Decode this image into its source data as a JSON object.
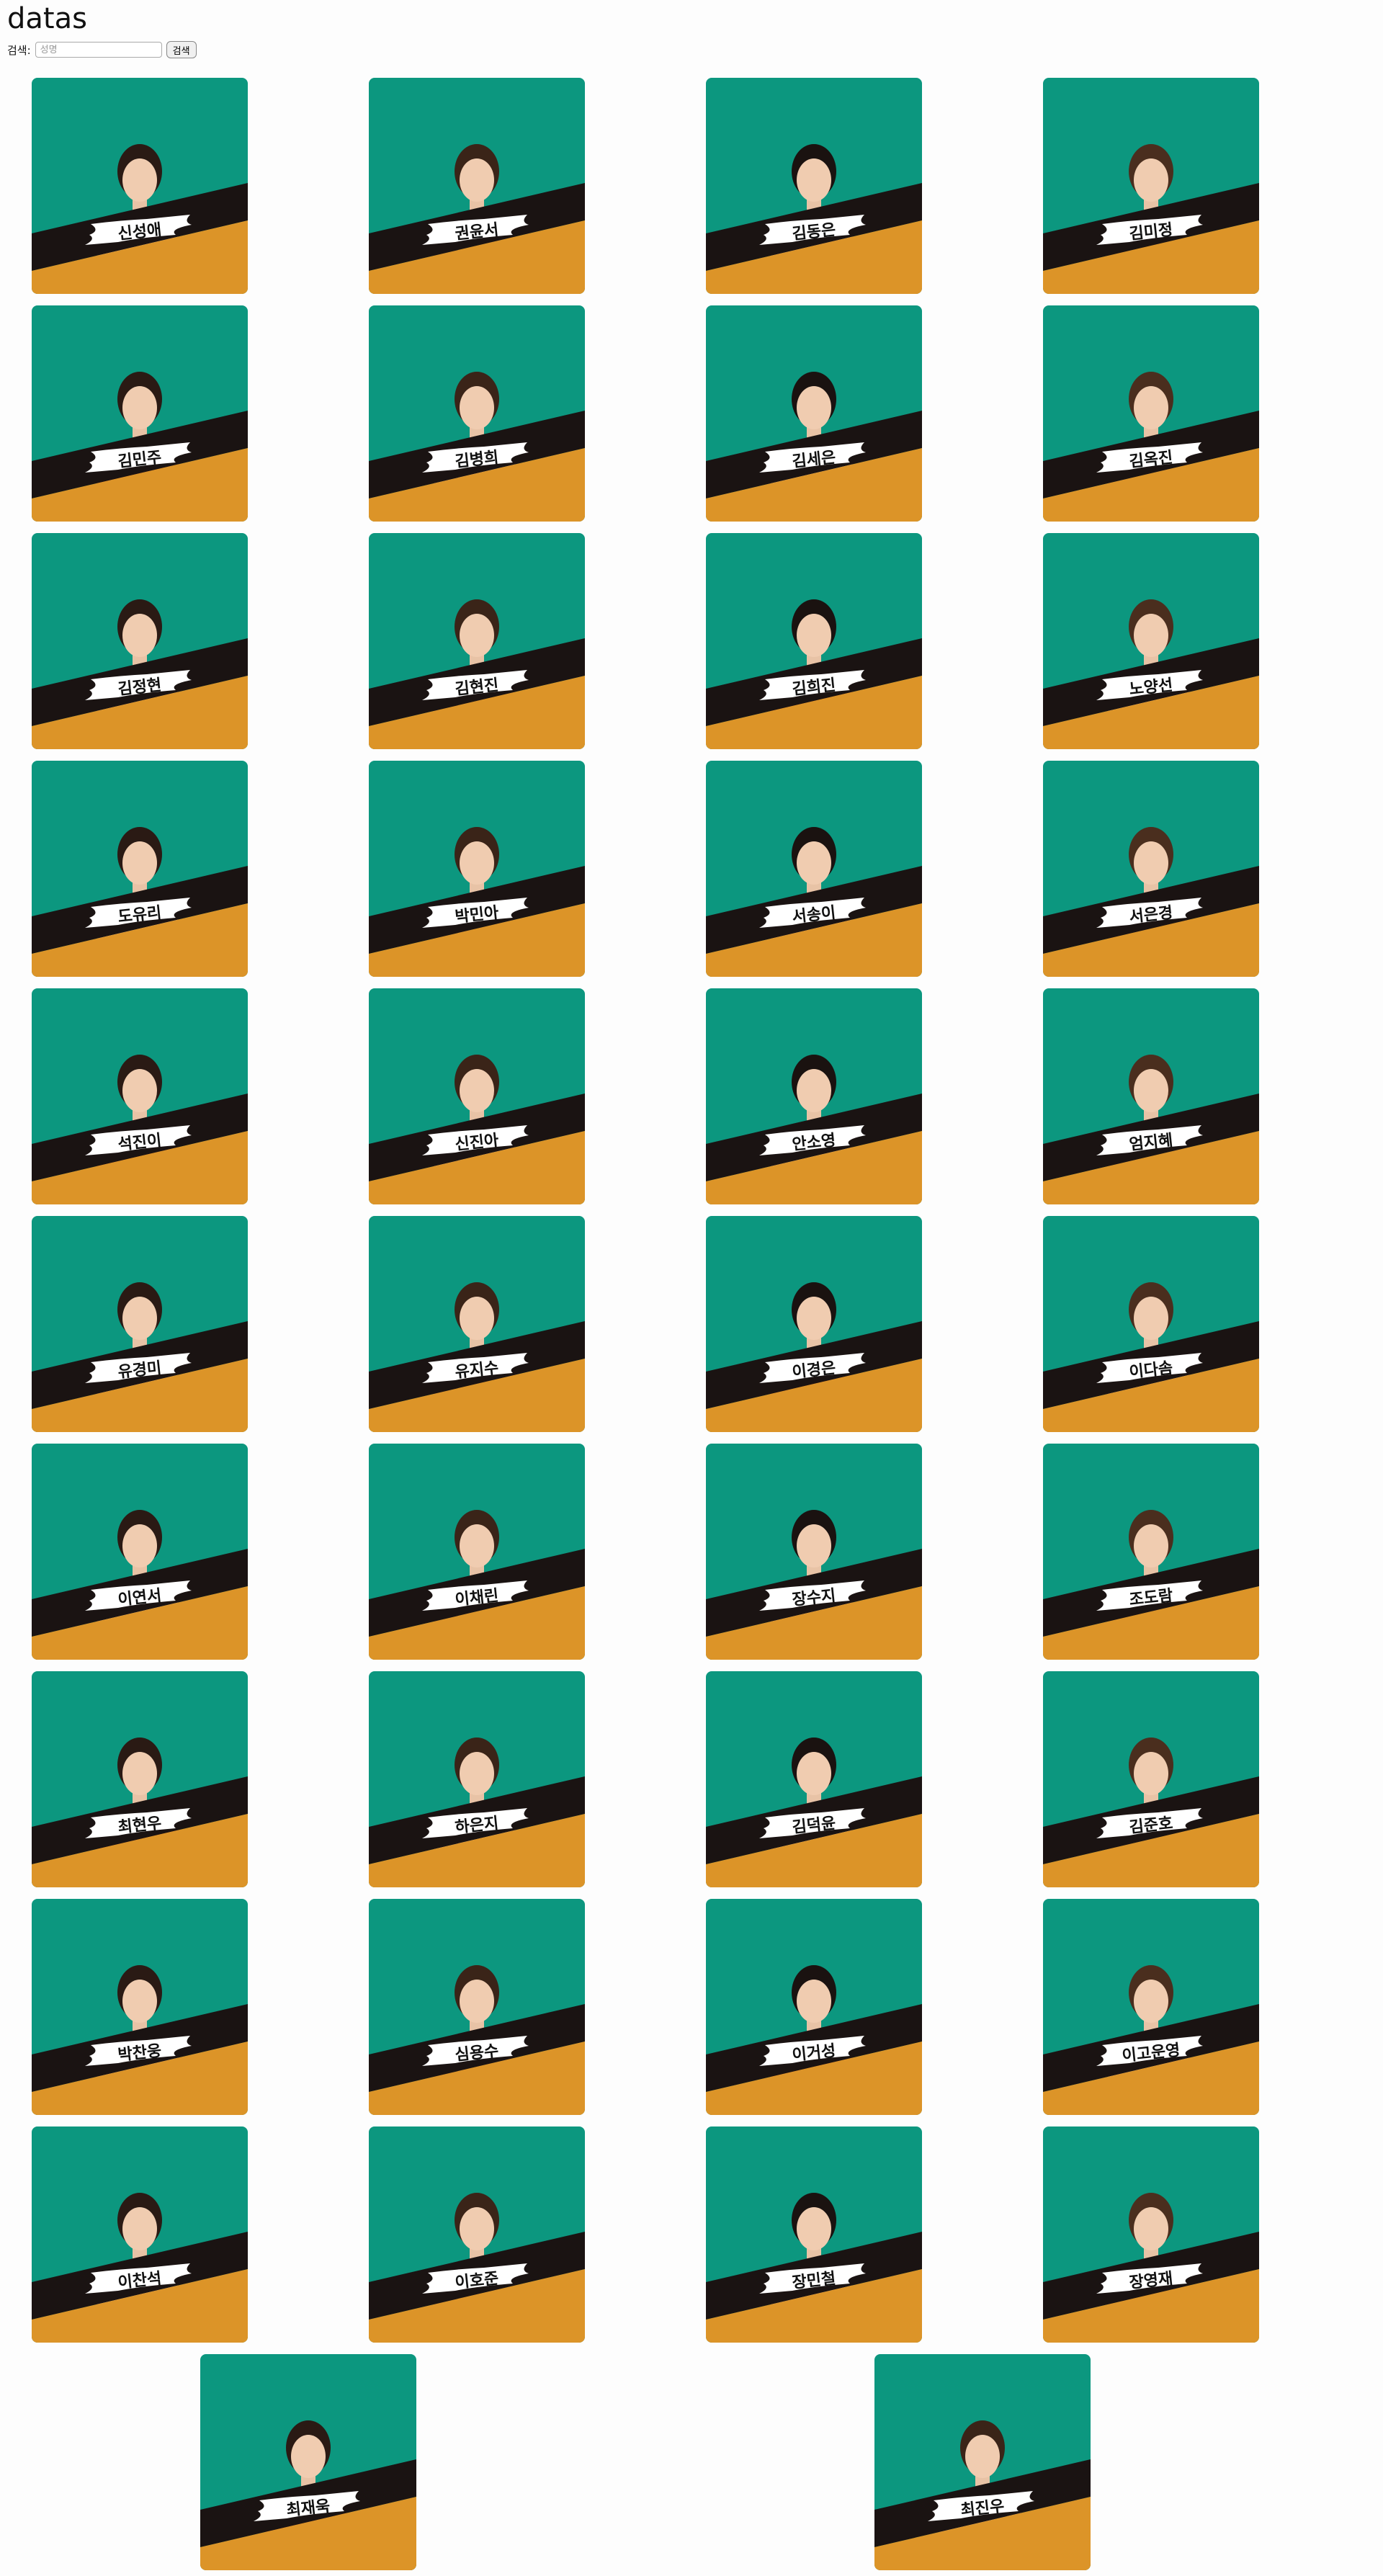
{
  "page": {
    "title": "datas"
  },
  "search": {
    "label": "검색:",
    "placeholder": "성명",
    "button_label": "검색"
  },
  "colors": {
    "card_top": "#0c977f",
    "card_stripe": "#1a1312",
    "card_bottom": "#dc9428",
    "name_tag_bg": "#ffffff",
    "name_text": "#111111"
  },
  "people": [
    {
      "name": "신성애",
      "avatar": "person-photo"
    },
    {
      "name": "권윤서",
      "avatar": "person-photo"
    },
    {
      "name": "김동은",
      "avatar": "person-photo"
    },
    {
      "name": "김미정",
      "avatar": "person-photo"
    },
    {
      "name": "김민주",
      "avatar": "person-photo"
    },
    {
      "name": "김병희",
      "avatar": "person-photo"
    },
    {
      "name": "김세은",
      "avatar": "person-photo"
    },
    {
      "name": "김옥진",
      "avatar": "person-photo"
    },
    {
      "name": "김정현",
      "avatar": "person-photo"
    },
    {
      "name": "김현진",
      "avatar": "person-photo"
    },
    {
      "name": "김희진",
      "avatar": "person-photo"
    },
    {
      "name": "노양선",
      "avatar": "person-photo"
    },
    {
      "name": "도유리",
      "avatar": "person-photo"
    },
    {
      "name": "박민아",
      "avatar": "person-photo"
    },
    {
      "name": "서송이",
      "avatar": "person-photo"
    },
    {
      "name": "서은경",
      "avatar": "person-photo"
    },
    {
      "name": "석진이",
      "avatar": "person-photo"
    },
    {
      "name": "신진아",
      "avatar": "person-photo"
    },
    {
      "name": "안소영",
      "avatar": "person-photo"
    },
    {
      "name": "엄지혜",
      "avatar": "person-photo"
    },
    {
      "name": "유경미",
      "avatar": "person-photo"
    },
    {
      "name": "유지수",
      "avatar": "person-photo"
    },
    {
      "name": "이경은",
      "avatar": "person-photo"
    },
    {
      "name": "이다솜",
      "avatar": "person-photo"
    },
    {
      "name": "이연서",
      "avatar": "person-photo"
    },
    {
      "name": "이채린",
      "avatar": "person-photo"
    },
    {
      "name": "장수지",
      "avatar": "person-photo"
    },
    {
      "name": "조도람",
      "avatar": "person-photo"
    },
    {
      "name": "최현우",
      "avatar": "person-photo"
    },
    {
      "name": "하은지",
      "avatar": "person-photo"
    },
    {
      "name": "김덕윤",
      "avatar": "person-photo"
    },
    {
      "name": "김준호",
      "avatar": "person-photo"
    },
    {
      "name": "박찬웅",
      "avatar": "person-photo"
    },
    {
      "name": "심용수",
      "avatar": "person-photo"
    },
    {
      "name": "이거성",
      "avatar": "person-photo"
    },
    {
      "name": "이고운영",
      "avatar": "person-photo"
    },
    {
      "name": "이찬석",
      "avatar": "person-photo"
    },
    {
      "name": "이호준",
      "avatar": "person-photo"
    },
    {
      "name": "장민철",
      "avatar": "person-photo"
    },
    {
      "name": "장영재",
      "avatar": "person-photo"
    },
    {
      "name": "최재욱",
      "avatar": "person-photo"
    },
    {
      "name": "최진우",
      "avatar": "person-photo"
    }
  ]
}
